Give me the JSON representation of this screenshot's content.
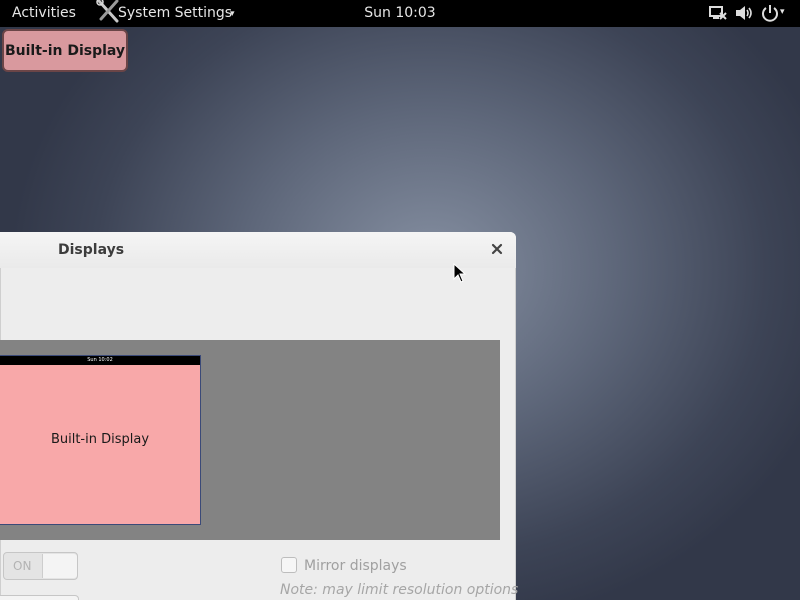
{
  "topbar": {
    "activities": "Activities",
    "app_menu": "System Settings",
    "app_menu_arrow": "▾",
    "clock": "Sun 10:03",
    "icons": [
      "network-icon",
      "volume-icon",
      "power-icon"
    ],
    "power_arrow": "▾"
  },
  "overlay": {
    "display_label": "Built-in Display"
  },
  "dialog": {
    "title": "Displays",
    "close_icon": "close-icon",
    "monitor": {
      "clock": "Sun 10:02",
      "name": "Built-in Display"
    },
    "switch_label": "ON",
    "mirror_label": "Mirror displays",
    "mirror_checked": false,
    "note": "Note: may limit resolution options"
  },
  "colors": {
    "topbar": "#000000",
    "label_bg": "#d9999e",
    "monitor_bg": "#f8a8a9",
    "arrangement_bg": "#838383",
    "dialog_bg": "#ededed"
  }
}
